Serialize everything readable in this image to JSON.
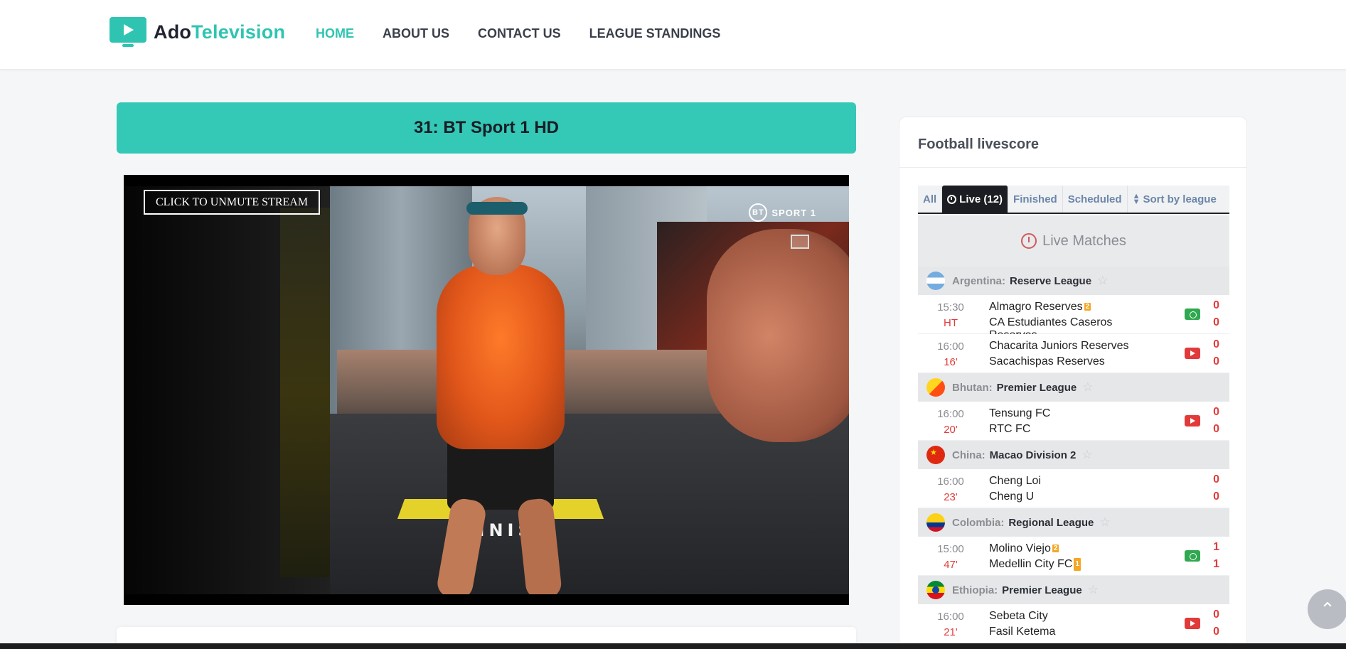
{
  "brand": {
    "name_part1": "Ado",
    "name_part2": "Television"
  },
  "nav": [
    {
      "label": "HOME",
      "active": true
    },
    {
      "label": "ABOUT US"
    },
    {
      "label": "CONTACT US"
    },
    {
      "label": "LEAGUE STANDINGS"
    }
  ],
  "channel": {
    "title": "31: BT Sport 1 HD"
  },
  "player": {
    "unmute_label": "CLICK TO UNMUTE STREAM",
    "overlay_logo": "SPORT 1",
    "overlay_logo_short": "BT",
    "scene_text": "FINISH"
  },
  "sidebar": {
    "title": "Football livescore",
    "tabs": [
      {
        "label": "All"
      },
      {
        "label": "Live (12)",
        "active": true,
        "icon": "clock-icon"
      },
      {
        "label": "Finished"
      },
      {
        "label": "Scheduled"
      },
      {
        "label": "Sort by league",
        "icon": "sort-icon"
      }
    ],
    "live_heading": "Live Matches",
    "leagues": [
      {
        "country": "Argentina:",
        "league": "Reserve League",
        "flag": "ar",
        "matches": [
          {
            "time": "15:30",
            "status": "HT",
            "home": "Almagro Reserves",
            "home_card": "2",
            "away": "CA Estudiantes Caseros Reserves",
            "icon": "field",
            "score_home": "0",
            "score_away": "0"
          },
          {
            "time": "16:00",
            "status": "16'",
            "home": "Chacarita Juniors Reserves",
            "away": "Sacachispas Reserves",
            "icon": "video",
            "score_home": "0",
            "score_away": "0"
          }
        ]
      },
      {
        "country": "Bhutan:",
        "league": "Premier League",
        "flag": "bt",
        "matches": [
          {
            "time": "16:00",
            "status": "20'",
            "home": "Tensung FC",
            "away": "RTC FC",
            "icon": "video",
            "score_home": "0",
            "score_away": "0"
          }
        ]
      },
      {
        "country": "China:",
        "league": "Macao Division 2",
        "flag": "cn",
        "matches": [
          {
            "time": "16:00",
            "status": "23'",
            "home": "Cheng Loi",
            "away": "Cheng U",
            "icon": "",
            "score_home": "0",
            "score_away": "0"
          }
        ]
      },
      {
        "country": "Colombia:",
        "league": "Regional League",
        "flag": "co",
        "matches": [
          {
            "time": "15:00",
            "status": "47'",
            "home": "Molino Viejo",
            "home_card": "2",
            "away": "Medellin City FC",
            "away_card": "1",
            "icon": "field",
            "score_home": "1",
            "score_away": "1"
          }
        ]
      },
      {
        "country": "Ethiopia:",
        "league": "Premier League",
        "flag": "et",
        "matches": [
          {
            "time": "16:00",
            "status": "21'",
            "home": "Sebeta City",
            "away": "Fasil Ketema",
            "icon": "video",
            "score_home": "0",
            "score_away": "0"
          }
        ]
      }
    ]
  },
  "scroll_top": {
    "icon": "chevron-up-icon",
    "glyph": "⌃"
  },
  "colors": {
    "accent": "#2fc4b2",
    "channel_bar": "#34c8b7",
    "live_red": "#e33b3b"
  }
}
